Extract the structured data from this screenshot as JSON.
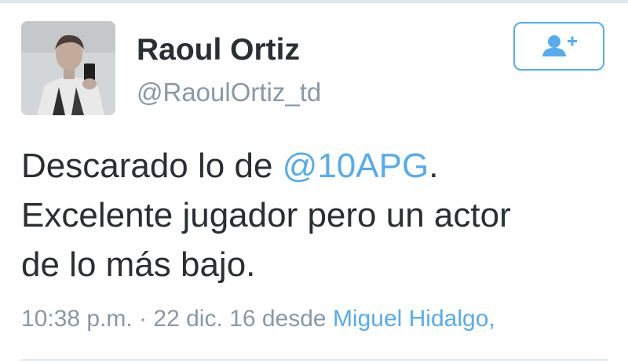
{
  "tweet": {
    "user": {
      "name": "Raoul Ortiz",
      "handle": "@RaoulOrtiz_td",
      "avatar_icon": "avatar-photo"
    },
    "follow_button": {
      "icon": "add-user-icon"
    },
    "text": {
      "line1_prefix": "Descarado lo de ",
      "mention": "@10APG",
      "line1_suffix": ".",
      "line2": "Excelente jugador pero un actor",
      "line3": "de lo más bajo."
    },
    "meta": {
      "timestamp": "10:38 p.m. · 22 dic. 16",
      "source_prefix": " desde ",
      "location": "Miguel Hidalgo,"
    }
  },
  "colors": {
    "accent": "#55acee",
    "text": "#292f33",
    "muted": "#8899a6"
  }
}
